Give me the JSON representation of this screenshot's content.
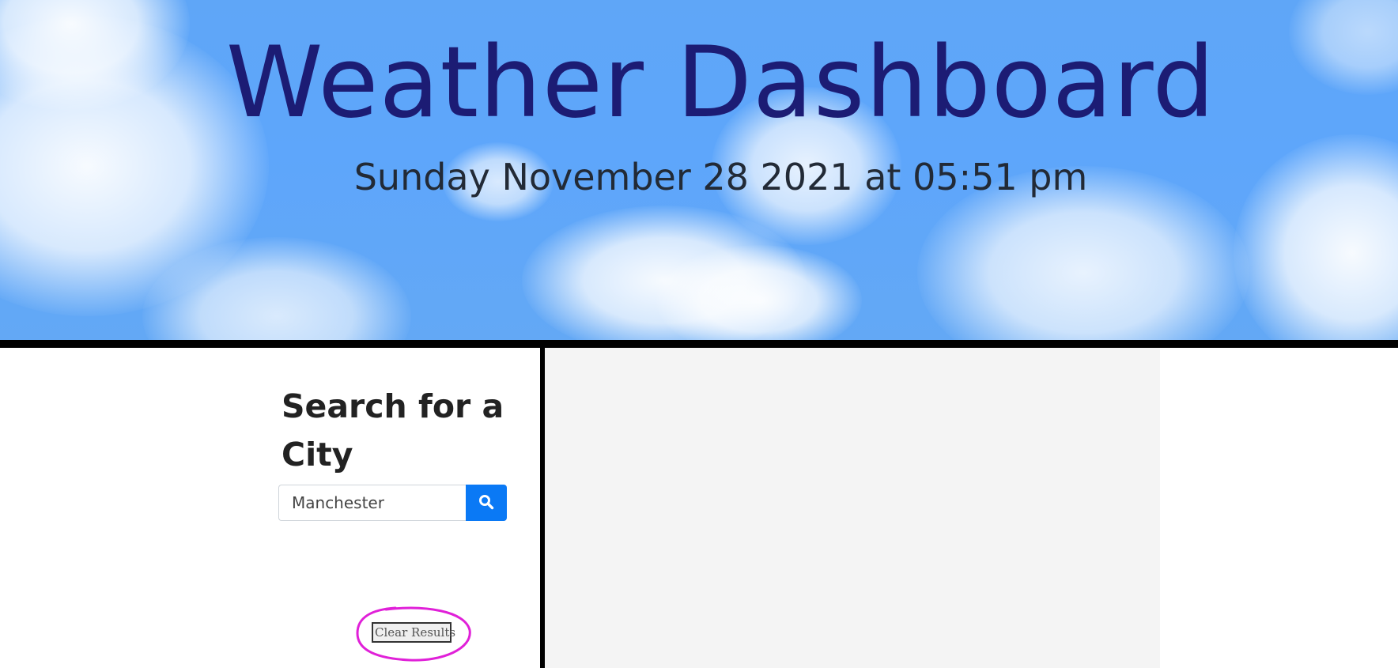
{
  "header": {
    "title": "Weather Dashboard",
    "datetime": "Sunday November 28 2021 at 05:51 pm"
  },
  "sidebar": {
    "heading": "Search for a City",
    "search": {
      "value": "Manchester",
      "placeholder": ""
    },
    "search_button_icon": "search-icon",
    "clear_label": "Clear Results",
    "annotation_color": "#e020d8"
  },
  "colors": {
    "title": "#1c1c74",
    "search_button": "#0a79f5",
    "results_panel": "#f4f4f4"
  }
}
